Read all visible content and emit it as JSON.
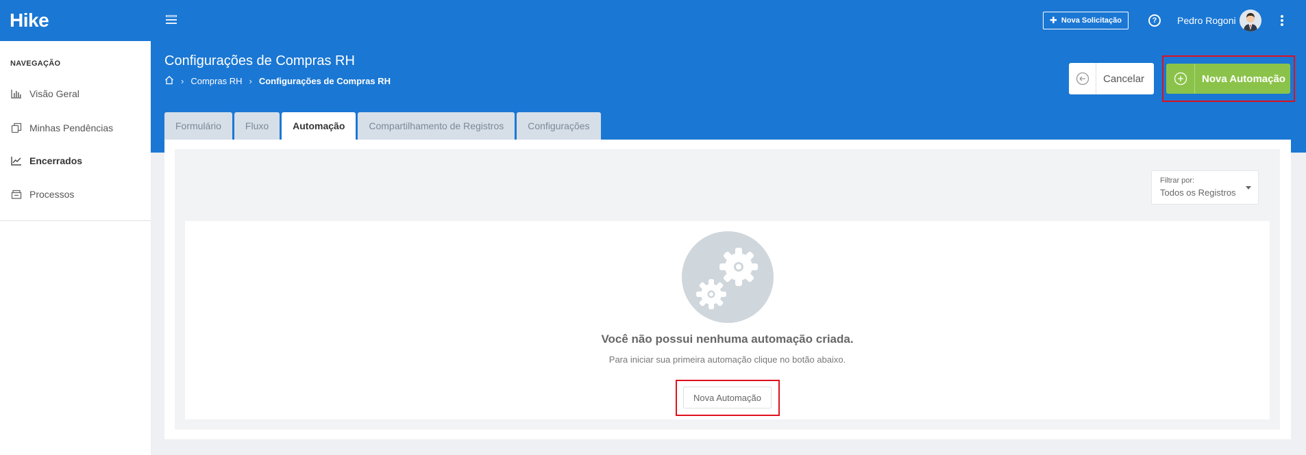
{
  "app": {
    "logo": "Hike"
  },
  "topbar": {
    "new_request_label": "Nova Solicitação",
    "help_label": "?",
    "user_name": "Pedro Rogoni"
  },
  "sidebar": {
    "title": "NAVEGAÇÃO",
    "items": [
      {
        "label": "Visão Geral",
        "icon": "bar-chart-icon"
      },
      {
        "label": "Minhas Pendências",
        "icon": "copy-icon"
      },
      {
        "label": "Encerrados",
        "icon": "trend-line-icon"
      },
      {
        "label": "Processos",
        "icon": "inbox-icon"
      }
    ]
  },
  "header": {
    "title": "Configurações de Compras RH",
    "breadcrumb": [
      "Compras RH",
      "Configurações de Compras RH"
    ],
    "cancel_label": "Cancelar",
    "new_automation_label": "Nova Automação"
  },
  "tabs": [
    {
      "label": "Formulário"
    },
    {
      "label": "Fluxo"
    },
    {
      "label": "Automação",
      "active": true
    },
    {
      "label": "Compartilhamento de Registros"
    },
    {
      "label": "Configurações"
    }
  ],
  "filter": {
    "label": "Filtrar por:",
    "value": "Todos os Registros"
  },
  "empty_state": {
    "title": "Você não possui nenhuma automação criada.",
    "description": "Para iniciar sua primeira automação clique no botão abaixo.",
    "button_label": "Nova Automação",
    "icon": "gears-icon"
  },
  "colors": {
    "primary": "#1a77d4",
    "success": "#8bc34a",
    "highlight": "#e0101f"
  }
}
